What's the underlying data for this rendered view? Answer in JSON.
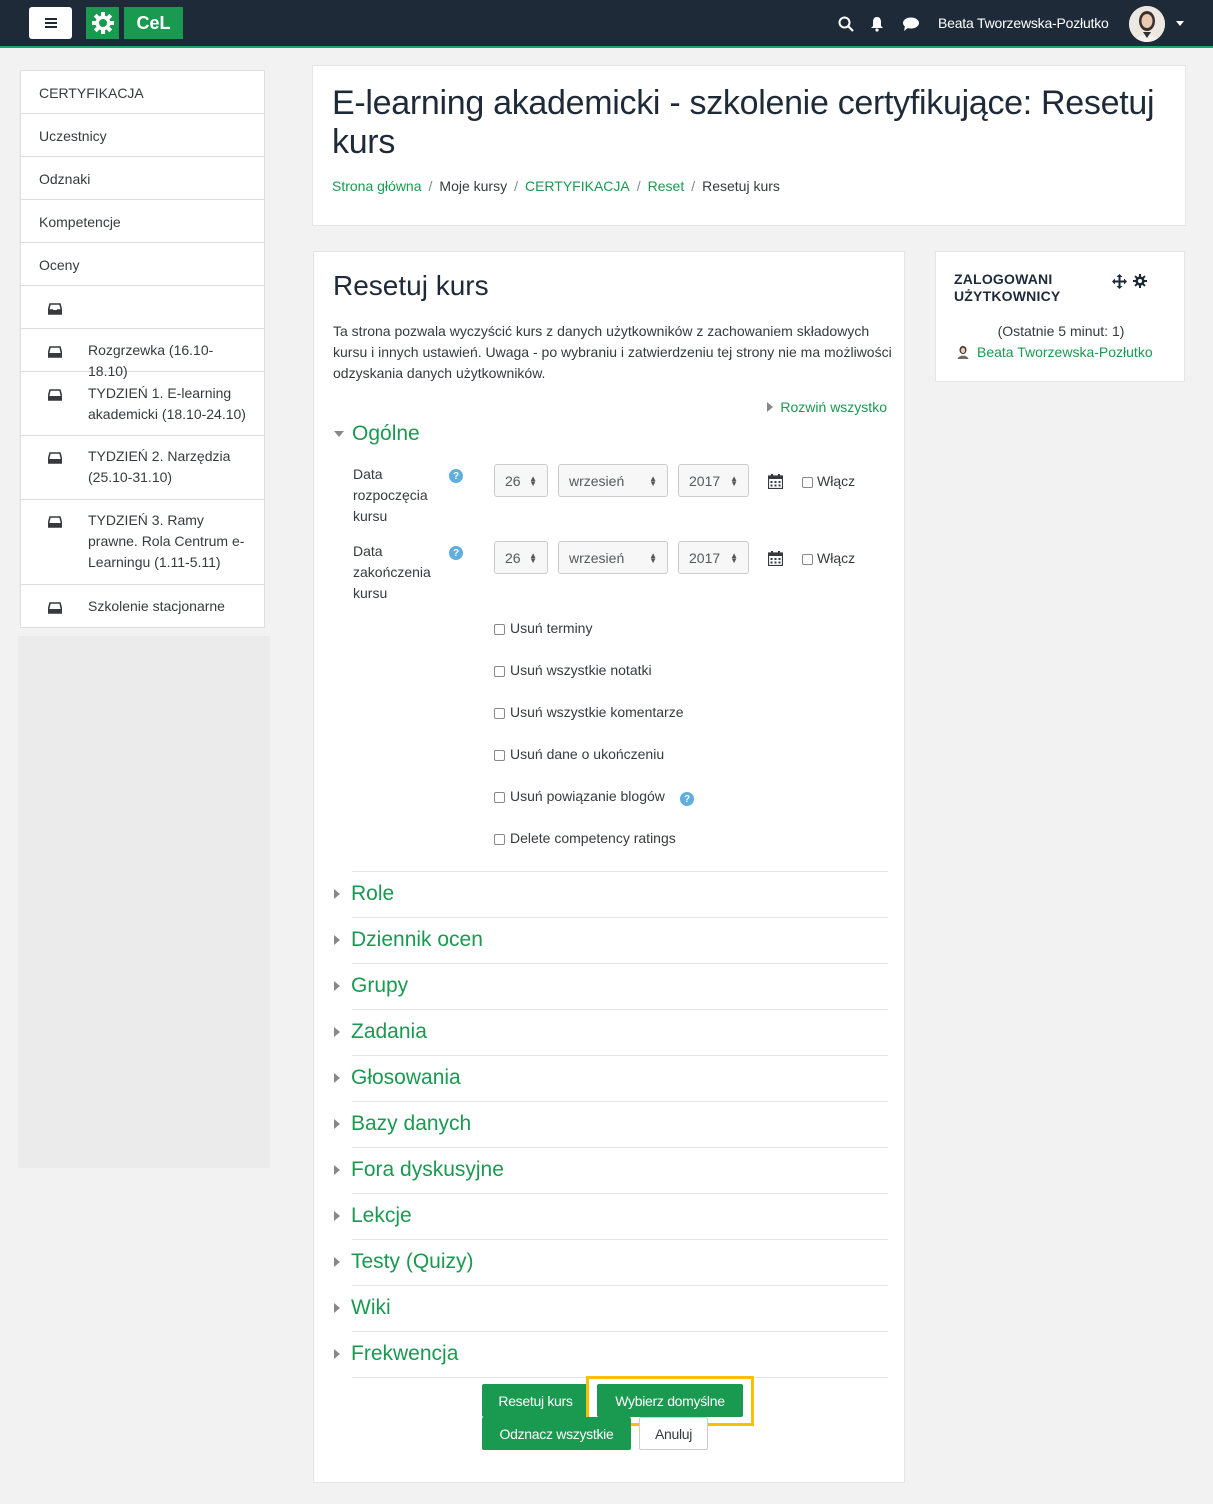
{
  "navbar": {
    "logo_text": "CeL",
    "user_name": "Beata Tworzewska-Pozłutko"
  },
  "drawer": {
    "items": [
      {
        "label": "CERTYFIKACJA"
      },
      {
        "label": "Uczestnicy"
      },
      {
        "label": "Odznaki"
      },
      {
        "label": "Kompetencje"
      },
      {
        "label": "Oceny"
      },
      {
        "label": ""
      },
      {
        "label": "Rozgrzewka (16.10-18.10)"
      },
      {
        "label": "TYDZIEŃ 1. E-learning akademicki (18.10-24.10)"
      },
      {
        "label": "TYDZIEŃ 2. Narzędzia (25.10-31.10)"
      },
      {
        "label": "TYDZIEŃ 3. Ramy prawne. Rola Centrum e-Learningu (1.11-5.11)"
      },
      {
        "label": "Szkolenie stacjonarne"
      }
    ]
  },
  "header": {
    "title": "E-learning akademicki - szkolenie certyfikujące: Resetuj kurs",
    "breadcrumb": [
      "Strona główna",
      "Moje kursy",
      "CERTYFIKACJA",
      "Reset",
      "Resetuj kurs"
    ]
  },
  "main": {
    "heading": "Resetuj kurs",
    "intro": "Ta strona pozwala wyczyścić kurs z danych użytkowników z zachowaniem składowych kursu i innych ustawień. Uwaga - po wybraniu i zatwierdzeniu tej strony nie ma możliwości odzyskania danych użytkowników.",
    "expand_all": "Rozwiń wszystko",
    "general_section": "Ogólne",
    "start_date": {
      "label": "Data rozpoczęcia kursu",
      "day": "26",
      "month": "wrzesień",
      "year": "2017",
      "enable": "Włącz"
    },
    "end_date": {
      "label": "Data zakończenia kursu",
      "day": "26",
      "month": "wrzesień",
      "year": "2017",
      "enable": "Włącz"
    },
    "options": [
      "Usuń terminy",
      "Usuń wszystkie notatki",
      "Usuń wszystkie komentarze",
      "Usuń dane o ukończeniu",
      "Usuń powiązanie blogów",
      "Delete competency ratings"
    ],
    "sections": [
      "Role",
      "Dziennik ocen",
      "Grupy",
      "Zadania",
      "Głosowania",
      "Bazy danych",
      "Fora dyskusyjne",
      "Lekcje",
      "Testy (Quizy)",
      "Wiki",
      "Frekwencja"
    ],
    "buttons": {
      "reset": "Resetuj kurs",
      "defaults": "Wybierz domyślne",
      "deselect": "Odznacz wszystkie",
      "cancel": "Anuluj"
    }
  },
  "users_block": {
    "title": "ZALOGOWANI UŻYTKOWNICY",
    "info": "(Ostatnie 5 minut: 1)",
    "user": "Beata Tworzewska-Pozłutko"
  },
  "colors": {
    "accent": "#1a9950",
    "navbar": "#1f2a38",
    "highlight": "#f7c000"
  }
}
